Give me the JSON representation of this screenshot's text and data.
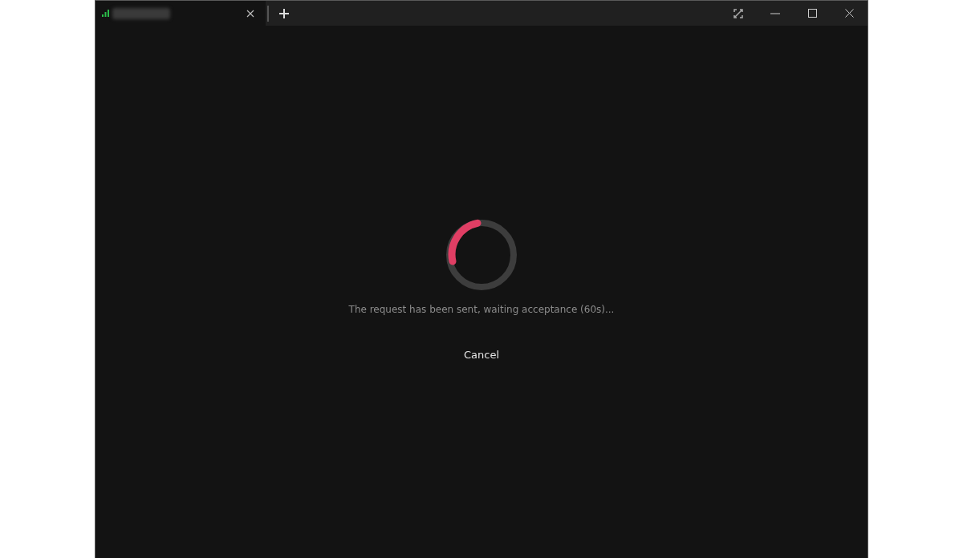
{
  "tabs": [
    {
      "selected": true
    }
  ],
  "status": {
    "message": "The request has been sent, waiting acceptance (60s)..."
  },
  "buttons": {
    "cancel": "Cancel"
  }
}
